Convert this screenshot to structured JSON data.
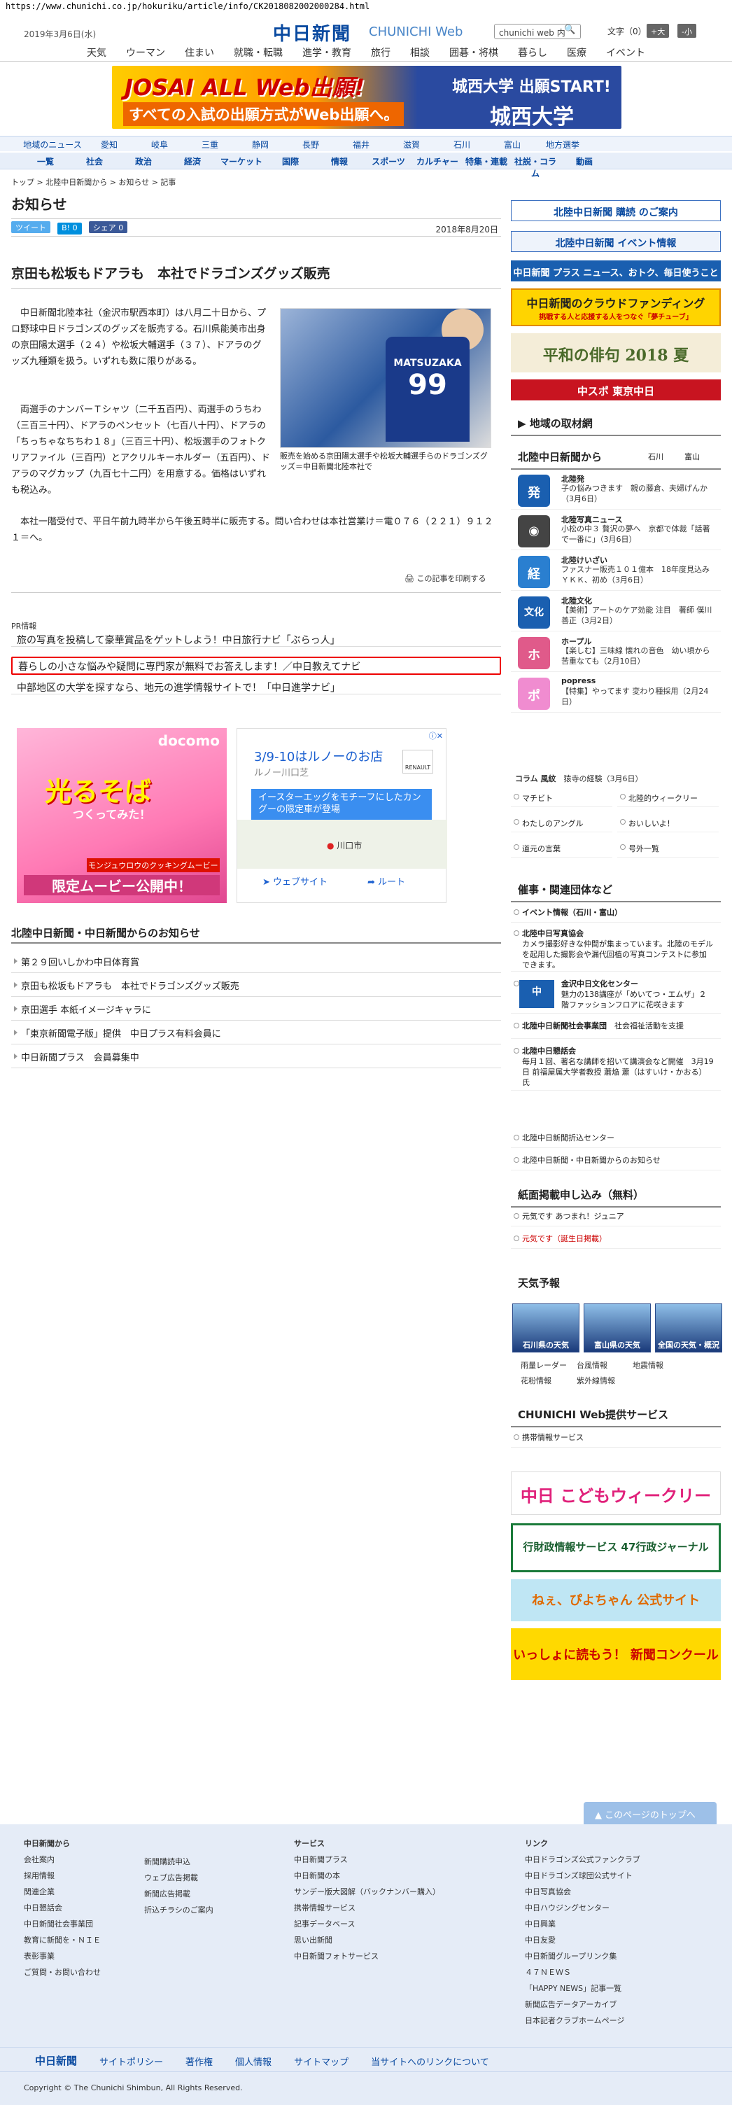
{
  "url": "https://www.chunichi.co.jp/hokuriku/article/info/CK2018082002000284.html",
  "header": {
    "date": "2019年3月6日(水)",
    "logo": "中日新聞",
    "logo_sub": "CHUNICHI Web",
    "search_placeholder": "chunichi web 内",
    "search_icon": "search-icon",
    "font_label": "文字（0）",
    "font_large": "+大",
    "font_small": "-小"
  },
  "gnav": [
    "天気",
    "ウーマン",
    "住まい",
    "就職・転職",
    "進学・教育",
    "旅行",
    "相談",
    "囲碁・将棋",
    "暮らし",
    "医療",
    "イベント"
  ],
  "banner": {
    "t1": "JOSAI ALL Web出願!",
    "t2": "すべての入試の出願方式がWeb出願へ。",
    "t3": "城西大学 出願START!",
    "t4": "城西大学"
  },
  "regnav": [
    "地域のニュース",
    "愛知",
    "岐阜",
    "三重",
    "静岡",
    "長野",
    "福井",
    "滋賀",
    "石川",
    "富山",
    "地方選挙"
  ],
  "catnav": [
    "一覧",
    "社会",
    "政治",
    "経済",
    "マーケット",
    "国際",
    "情報",
    "スポーツ",
    "カルチャー",
    "特集・連載",
    "社説・コラム",
    "動画"
  ],
  "breadcrumb": "トップ > 北陸中日新聞から > お知らせ > 記事",
  "section_title": "お知らせ",
  "share": {
    "tweet": "ツイート",
    "hatena": "B! 0",
    "fb": "シェア 0"
  },
  "article": {
    "date": "2018年8月20日",
    "headline": "京田も松坂もドアラも　本社でドラゴンズグッズ販売",
    "p1": "中日新聞北陸本社（金沢市駅西本町）は八月二十日から、プロ野球中日ドラゴンズのグッズを販売する。石川県能美市出身の京田陽太選手（２４）や松坂大輔選手（３７）、ドアラのグッズ九種類を扱う。いずれも数に限りがある。",
    "p2": "両選手のナンバーＴシャツ（二千五百円）、両選手のうちわ（三百三十円）、ドアラのペンセット（七百八十円）、ドアラの「ちっちゃなちちわ１８」（三百三十円）、松坂選手のフォトクリアファイル（三百円）とアクリルキーホルダー（五百円）、ドアラのマグカップ（九百七十二円）を用意する。価格はいずれも税込み。",
    "p3": "本社一階受付で、平日午前九時半から午後五時半に販売する。問い合わせは本社営業け＝電０７６（２２１）９１２１＝へ。",
    "photo_text1": "MATSUZAKA",
    "photo_text2": "99",
    "caption": "販売を始める京田陽太選手や松坂大輔選手らのドラゴンズグッズ＝中日新聞北陸本社で",
    "print": "この記事を印刷する"
  },
  "pr": {
    "title": "PR情報",
    "items": [
      "旅の写真を投稿して豪華賞品をゲットしよう！中日旅行ナビ「ぶらっ人」",
      "暮らしの小さな悩みや疑問に専門家が無料でお答えします！／中日教えてナビ",
      "中部地区の大学を探すなら、地元の進学情報サイトで！「中日進学ナビ」"
    ]
  },
  "ad1": {
    "docomo": "docomo",
    "t1": "光るそば",
    "t2": "つくってみた！",
    "t3": "モンジュウロウのクッキングムービー",
    "t4": "限定ムービー公開中！"
  },
  "ad2": {
    "t1": "3/9-10はルノーのお店",
    "t2": "ルノー川口芝",
    "brand": "RENAULT",
    "blue": "イースターエッグをモチーフにしたカングーの限定車が登場",
    "city": "川口市",
    "web": "ウェブサイト",
    "route": "ルート"
  },
  "notices": {
    "title": "北陸中日新聞・中日新聞からのお知らせ",
    "items": [
      "第２９回いしかわ中日体育賞",
      "京田も松坂もドアラも　本社でドラゴンズグッズ販売",
      "京田選手 本紙イメージキャラに",
      "「東京新聞電子版」提供　中日プラス有料会員に",
      "中日新聞プラス　会員募集中"
    ]
  },
  "sidebar": {
    "subscribe": "北陸中日新聞 購読 のご案内",
    "event": "北陸中日新聞 イベント情報",
    "plus": "中日新聞 プラス ニュース、おトク、毎日使うこと",
    "cf": "中日新聞のクラウドファンディング",
    "cf_sub": "挑戦する人と応援する人をつなぐ「夢チューブ」",
    "haiku": "平和の俳句 2018 夏",
    "sports": "中スポ 東京中日",
    "local_title": "地域の取材網",
    "hokuriku_title": "北陸中日新聞から",
    "hokuriku_links": [
      "石川",
      "富山"
    ],
    "items": [
      {
        "icon": "発",
        "color": "#1a5fb0",
        "title": "北陸発",
        "desc": "子の悩みつきます　親の藤倉、夫婦げんか（3月6日）"
      },
      {
        "icon": "◉",
        "color": "#444",
        "title": "北陸写真ニュース",
        "desc": "小松の中３ 贅沢の夢へ　京都で体裁「話著で一番に」（3月6日）"
      },
      {
        "icon": "経",
        "color": "#2a7fd0",
        "title": "北陸けいざい",
        "desc": "ファスナー販売１０１億本　18年度見込み ＹＫＫ、初め（3月6日）"
      },
      {
        "icon": "文化",
        "color": "#1a5fb0",
        "title": "北陸文化",
        "desc": "【美術】アートのケア効能 注目　著師 僕川善正（3月2日）"
      },
      {
        "icon": "ホ",
        "color": "#e05a8a",
        "title": "ホープル",
        "desc": "【楽しむ】三味線 懐れの音色　幼い頃から 苦重なても（2月10日）"
      },
      {
        "icon": "ポ",
        "color": "#f08cd0",
        "title": "popress",
        "desc": "【特集】やってます 変わり種採用（2月24日）"
      }
    ],
    "column_label": "コラム 風紋",
    "column_text": "猿寺の経験（3月6日）",
    "links": [
      "マチビト",
      "北陸的ウィークリー",
      "わたしのアングル",
      "おいしいよ！",
      "道元の言葉",
      "号外一覧"
    ],
    "events_title": "催事・関連団体など",
    "events_sub": "イベント情報（石川・富山）",
    "event_items": [
      {
        "title": "北陸中日写真協会",
        "desc": "カメラ撮影好きな仲間が集まっています。北陸のモデルを起用した撮影会や漏代回植の写真コンテストに参加できます。"
      },
      {
        "title": "金沢中日文化センター",
        "desc": "魅力の138講座が「めいてつ・エムザ」２階ファッションフロアに花咲きます"
      },
      {
        "title": "北陸中日新聞社会事業団",
        "desc": "社会福祉活動を支援"
      },
      {
        "title": "北陸中日懇話会",
        "desc": "毎月１回、著名な講師を招いて講演会など開催　3月19日 前福屋属大学者教授 蕭焔 蕭（はすいけ・かおる）氏"
      },
      {
        "title": "北陸中日新聞折込センター",
        "desc": ""
      },
      {
        "title": "北陸中日新聞・中日新聞からのお知らせ",
        "desc": ""
      }
    ],
    "apply_title": "紙面掲載申し込み（無料）",
    "apply_items": [
      "元気です あつまれ！ジュニア",
      "元気です（誕生日掲載）"
    ],
    "weather_title": "天気予報",
    "weather": [
      "石川県の天気",
      "富山県の天気",
      "全国の天気・概況"
    ],
    "weather_links": [
      "雨量レーダー",
      "台風情報",
      "地震情報",
      "花粉情報",
      "紫外線情報"
    ],
    "services_title": "CHUNICHI Web提供サービス",
    "services_links": [
      "携帯情報サービス"
    ],
    "kodomo": "中日 こどもウィークリー",
    "gyosei": "行財政情報サービス 47行政ジャーナル",
    "manga": "ねぇ、ぴよちゃん 公式サイト",
    "nie": "いっしょに読もう！ 新聞コンクール"
  },
  "pagetop": "このページのトップへ",
  "footer": {
    "col1_title": "中日新聞から",
    "col1": [
      "会社案内",
      "採用情報",
      "関連企業",
      "中日懇話会",
      "中日新聞社会事業団",
      "教育に新聞を・ＮＩＥ",
      "表彰事業",
      "ご質問・お問い合わせ"
    ],
    "col2": [
      "新聞購読申込",
      "ウェブ広告掲載",
      "新聞広告掲載",
      "折込チラシのご案内"
    ],
    "col3_title": "サービス",
    "col3": [
      "中日新聞プラス",
      "中日新聞の本",
      "サンデー版大図解（バックナンバー購入）",
      "携帯情報サービス",
      "記事データベース",
      "思い出新聞",
      "中日新聞フォトサービス"
    ],
    "col4_title": "リンク",
    "col4": [
      "中日ドラゴンズ公式ファンクラブ",
      "中日ドラゴンズ球団公式サイト",
      "中日写真協会",
      "中日ハウジングセンター",
      "中日興業",
      "中日友愛",
      "中日新聞グループリンク集",
      "４７ＮＥＷＳ",
      "「HAPPY NEWS」記事一覧",
      "新聞広告データアーカイブ",
      "日本記者クラブホームページ"
    ],
    "nav_logo": "中日新聞",
    "nav": [
      "サイトポリシー",
      "著作権",
      "個人情報",
      "サイトマップ",
      "当サイトへのリンクについて"
    ],
    "copyright": "Copyright © The Chunichi Shimbun, All Rights Reserved."
  }
}
